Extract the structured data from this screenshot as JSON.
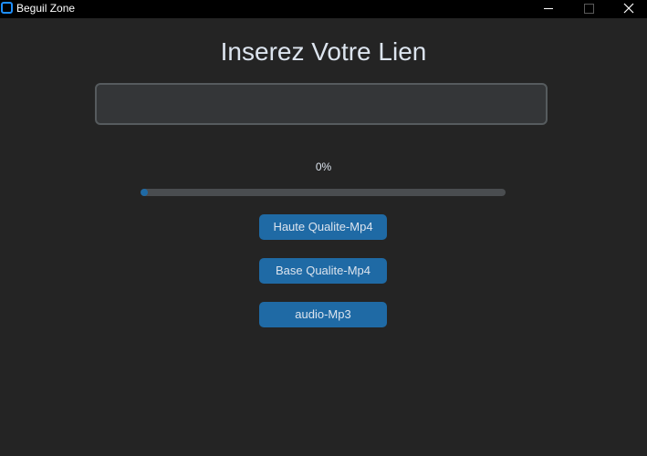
{
  "window": {
    "title": "Beguil Zone",
    "icon": "app-logo-icon",
    "controls": [
      "minimize-icon",
      "maximize-icon",
      "close-icon"
    ]
  },
  "main": {
    "heading": "Inserez Votre Lien",
    "link_input": {
      "value": "",
      "placeholder": ""
    },
    "progress": {
      "label": "0%",
      "value": 0.02
    },
    "buttons": {
      "high_quality": "Haute Qualite-Mp4",
      "low_quality": "Base Qualite-Mp4",
      "audio": "audio-Mp3"
    }
  },
  "colors": {
    "background": "#242424",
    "titlebar": "#000000",
    "accent": "#1f6aa5",
    "input_bg": "#343638",
    "input_border": "#565b5e",
    "track": "#4a4d50",
    "text": "#dce4ee"
  }
}
